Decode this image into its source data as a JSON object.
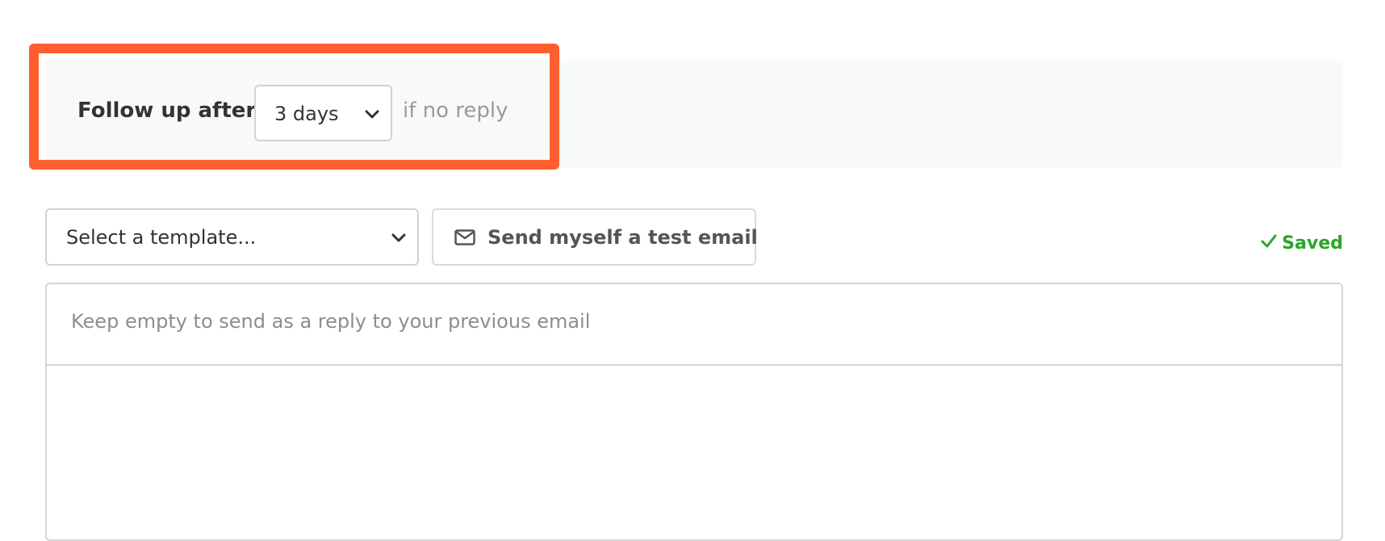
{
  "followup": {
    "label": "Follow up after",
    "delay_value": "3 days",
    "suffix": "if no reply"
  },
  "toolbar": {
    "template_placeholder": "Select a template...",
    "test_email_label": "Send myself a test email",
    "saved_label": "Saved"
  },
  "editor": {
    "subject_placeholder": "Keep empty to send as a reply to your previous email"
  },
  "icons": {
    "delay_select": "chevron-down-icon",
    "template_select": "chevron-down-icon",
    "test_email": "envelope-icon",
    "saved": "check-icon"
  },
  "colors": {
    "highlight": "#ff5f2e",
    "saved": "#2aa52a",
    "panel_background": "#f8f9f9"
  }
}
